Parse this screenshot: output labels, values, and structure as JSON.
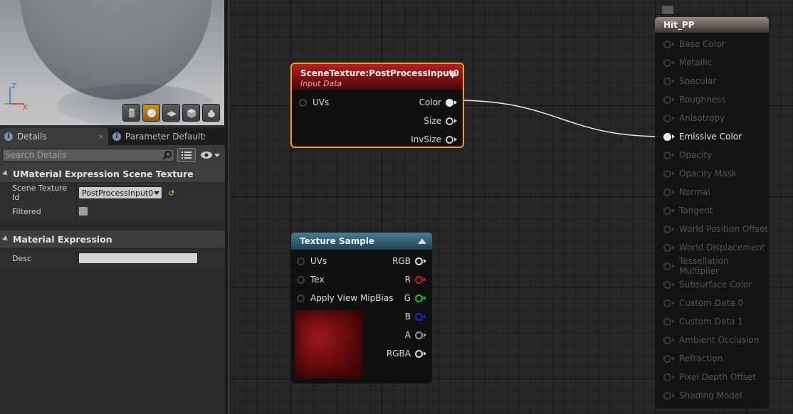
{
  "details_panel": {
    "tabs": [
      {
        "label": "Details",
        "close": "×"
      },
      {
        "label": "Parameter Defaults"
      }
    ],
    "search": {
      "placeholder": "Search Details"
    },
    "categories": [
      {
        "label": "UMaterial Expression Scene Texture",
        "properties": [
          {
            "label": "Scene Texture Id",
            "value": "PostProcessInput0"
          },
          {
            "label": "Filtered",
            "checked": false
          }
        ]
      },
      {
        "label": "Material Expression",
        "properties": [
          {
            "label": "Desc",
            "value": ""
          }
        ]
      }
    ]
  },
  "viewport": {
    "axis": {
      "z": "Z",
      "x": "X"
    },
    "tool_icons": [
      "cylinder-icon",
      "sphere-icon",
      "plane-icon",
      "cube-icon",
      "teapot-icon"
    ],
    "active_tool": "sphere-icon"
  },
  "graph": {
    "scene_texture_node": {
      "title": "SceneTexture:PostProcessInput0",
      "subtitle": "Input Data",
      "inputs": [
        "UVs"
      ],
      "outputs": [
        "Color",
        "Size",
        "InvSize"
      ]
    },
    "texture_sample_node": {
      "title": "Texture Sample",
      "inputs": [
        "UVs",
        "Tex",
        "Apply View MipBias"
      ],
      "outputs": [
        {
          "label": "RGB",
          "color": "#e0e0e0"
        },
        {
          "label": "R",
          "color": "#d22020"
        },
        {
          "label": "G",
          "color": "#20c020"
        },
        {
          "label": "B",
          "color": "#2020e0"
        },
        {
          "label": "A",
          "color": "#9a9a9a"
        },
        {
          "label": "RGBA",
          "color": "#e0e0e0"
        }
      ]
    },
    "material_node": {
      "title": "Hit_PP",
      "inputs": [
        "Base Color",
        "Metallic",
        "Specular",
        "Roughness",
        "Anisotropy",
        "Emissive Color",
        "Opacity",
        "Opacity Mask",
        "Normal",
        "Tangent",
        "World Position Offset",
        "World Displacement",
        "Tessellation Multiplier",
        "Subsurface Color",
        "Custom Data 0",
        "Custom Data 1",
        "Ambient Occlusion",
        "Refraction",
        "Pixel Depth Offset",
        "Shading Model"
      ],
      "connected_input": "Emissive Color"
    }
  },
  "colors": {
    "selection_outline": "#f0a020",
    "scene_texture_header": "#b32020",
    "texture_sample_header": "#4a7b90",
    "wire": "#e8e8e8"
  }
}
